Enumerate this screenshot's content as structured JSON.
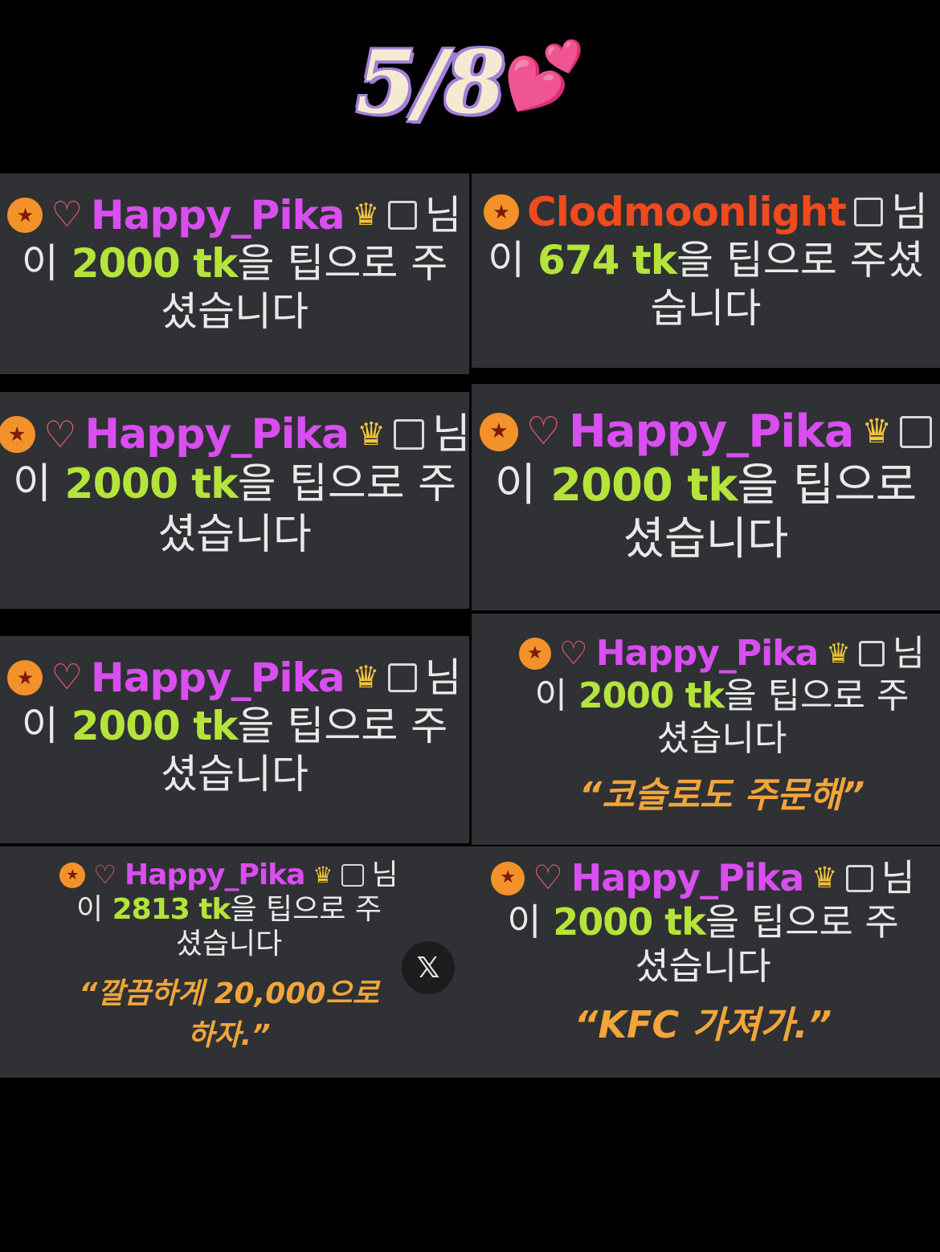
{
  "header": {
    "title": "5/8",
    "hearts": "💕"
  },
  "colors": {
    "background": "#000000",
    "panel": "#2f3134",
    "name_purple": "#d94ef0",
    "name_orange": "#f04a1e",
    "amount_green": "#b4e43a",
    "quote_orange": "#f2a53a",
    "title_fill": "#f4ead2",
    "title_outline": "#a27fd8"
  },
  "icons": {
    "star_badge": "★",
    "gem_badge": "♡",
    "crown": "♛",
    "close": "𝕏"
  },
  "tips": [
    {
      "username": "Happy_Pika",
      "suffix": "님",
      "prefix": "이",
      "amount": "2000 tk",
      "rest": "을 팁으로 주",
      "line3": "셨습니다",
      "message": ""
    },
    {
      "username": "Clodmoonlight",
      "suffix": "님",
      "prefix": "이",
      "amount": "674 tk",
      "rest": "을 팁으로 주셨",
      "line3": "습니다",
      "message": ""
    },
    {
      "username": "Happy_Pika",
      "suffix": "님",
      "prefix": "이",
      "amount": "2000 tk",
      "rest": "을 팁으로 주",
      "line3": "셨습니다",
      "message": ""
    },
    {
      "username": "Happy_Pika",
      "suffix": "",
      "prefix": "이",
      "amount": "2000 tk",
      "rest": "을 팁으로",
      "line3": "셨습니다",
      "message": ""
    },
    {
      "username": "Happy_Pika",
      "suffix": "님",
      "prefix": "이",
      "amount": "2000 tk",
      "rest": "을 팁으로 주",
      "line3": "셨습니다",
      "message": ""
    },
    {
      "username": "Happy_Pika",
      "suffix": "님",
      "prefix": "이",
      "amount": "2000 tk",
      "rest": "을 팁으로 주",
      "line3": "셨습니다",
      "message": "“코슬로도 주문해”"
    },
    {
      "username": "Happy_Pika",
      "suffix": "님",
      "prefix": "이",
      "amount": "2813 tk",
      "rest": "을 팁으로 주",
      "line3": "셨습니다",
      "message": "“깔끔하게 20,000으로",
      "message2": "하자.”"
    },
    {
      "username": "Happy_Pika",
      "suffix": "님",
      "prefix": "이",
      "amount": "2000 tk",
      "rest": "을 팁으로 주",
      "line3": "셨습니다",
      "message": "“KFC 가져가.”"
    }
  ]
}
